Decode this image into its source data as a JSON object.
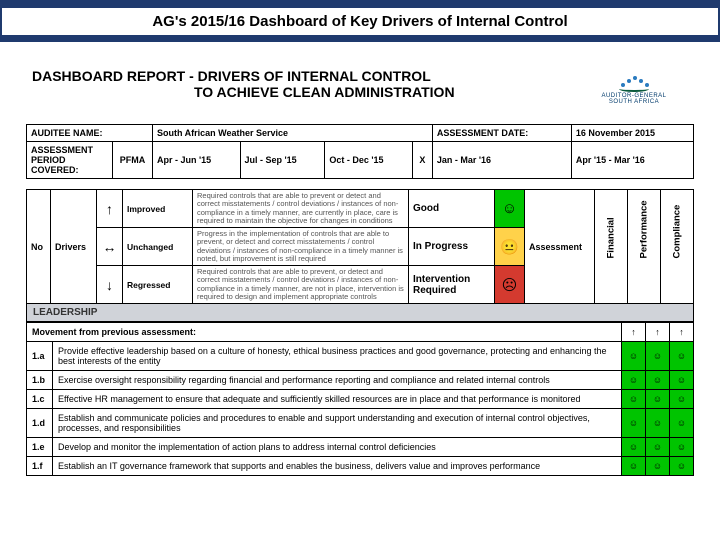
{
  "banner": {
    "title": "AG's 2015/16 Dashboard of Key Drivers of Internal Control"
  },
  "report": {
    "line1": "DASHBOARD REPORT -   DRIVERS OF INTERNAL CONTROL",
    "line2": "TO ACHIEVE CLEAN ADMINISTRATION"
  },
  "logo": {
    "line1": "AUDITOR-GENERAL",
    "line2": "SOUTH AFRICA"
  },
  "meta": {
    "auditee_lbl": "AUDITEE NAME:",
    "auditee_val": "South African Weather Service",
    "assess_date_lbl": "ASSESSMENT DATE:",
    "assess_date_val": "16 November 2015",
    "period_lbl": "ASSESSMENT PERIOD COVERED:",
    "pfma": "PFMA",
    "q1": "Apr - Jun '15",
    "q2": "Jul - Sep '15",
    "q3": "Oct - Dec '15",
    "q3_mark": "X",
    "q4": "Jan - Mar '16",
    "full": "Apr '15 - Mar '16"
  },
  "legend": {
    "no": "No",
    "drivers": "Drivers",
    "assessment": "Assessment",
    "improved_sym": "↑",
    "improved": "Improved",
    "unchanged_sym": "↔",
    "unchanged": "Unchanged",
    "regressed_sym": "↓",
    "regressed": "Regressed",
    "desc_good": "Required controls that are able to prevent or detect and correct misstatements / control deviations / instances of non-compliance in a timely manner, are currently in place, care is required to maintain the objective for changes in conditions",
    "desc_prog": "Progress in the implementation of controls that are able to prevent, or detect and correct misstatements / control deviations / instances of non-compliance in a timely manner is noted, but improvement is still required",
    "desc_bad": "Required controls that are able to prevent, or detect and correct misstatements / control deviations / instances of non-compliance in a timely manner, are not in place, intervention is required to design and implement appropriate controls",
    "good": "Good",
    "in_progress": "In Progress",
    "intervention": "Intervention Required",
    "financial": "Financial",
    "performance": "Performance",
    "compliance": "Compliance"
  },
  "section": {
    "leadership": "LEADERSHIP"
  },
  "movement": {
    "label": "Movement from previous assessment:",
    "fin": "↑",
    "perf": "↑",
    "comp": "↑"
  },
  "rows": [
    {
      "no": "1.a",
      "text": "Provide effective leadership based on a culture of honesty, ethical business practices and good governance, protecting and enhancing the best interests of the entity"
    },
    {
      "no": "1.b",
      "text": "Exercise oversight responsibility regarding financial and performance reporting and compliance and related internal controls"
    },
    {
      "no": "1.c",
      "text": "Effective HR management to ensure that adequate and sufficiently skilled resources are in place and that performance is monitored"
    },
    {
      "no": "1.d",
      "text": "Establish and communicate policies and procedures to enable and support understanding and execution of internal control objectives, processes, and responsibilities"
    },
    {
      "no": "1.e",
      "text": "Develop and monitor the implementation of action plans to address internal control deficiencies"
    },
    {
      "no": "1.f",
      "text": "Establish an IT governance framework that supports and enables the business, delivers value and improves performance"
    }
  ],
  "smile": "☺",
  "neutral": "😐",
  "frown": "☹"
}
